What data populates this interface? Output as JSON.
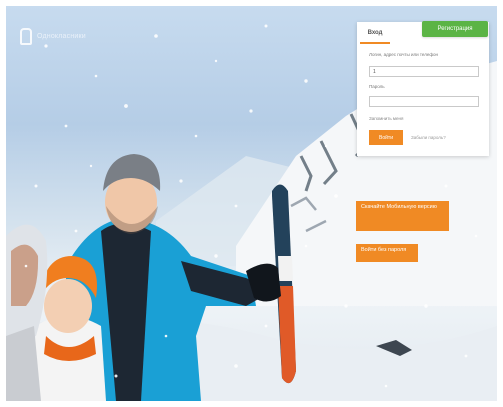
{
  "app": {
    "logo_text": "Однокласники",
    "signup_button": "Регистрация"
  },
  "login": {
    "tab_label": "Вход",
    "phone_label": "Логин, адрес почты или телефон",
    "phone_value": "1",
    "password_label": "Пароль",
    "password_value": "",
    "remember_label": "Запомнить меня",
    "login_button": "Войти",
    "forgot_link": "Забыли пароль?"
  },
  "promo": {
    "primary": "Скачайте Мобильную версию",
    "secondary": "Войти без пароля"
  },
  "footer": {
    "links": [
      "",
      "",
      "",
      "",
      ""
    ]
  },
  "colors": {
    "accent": "#f08a24",
    "signup": "#5bb445"
  }
}
